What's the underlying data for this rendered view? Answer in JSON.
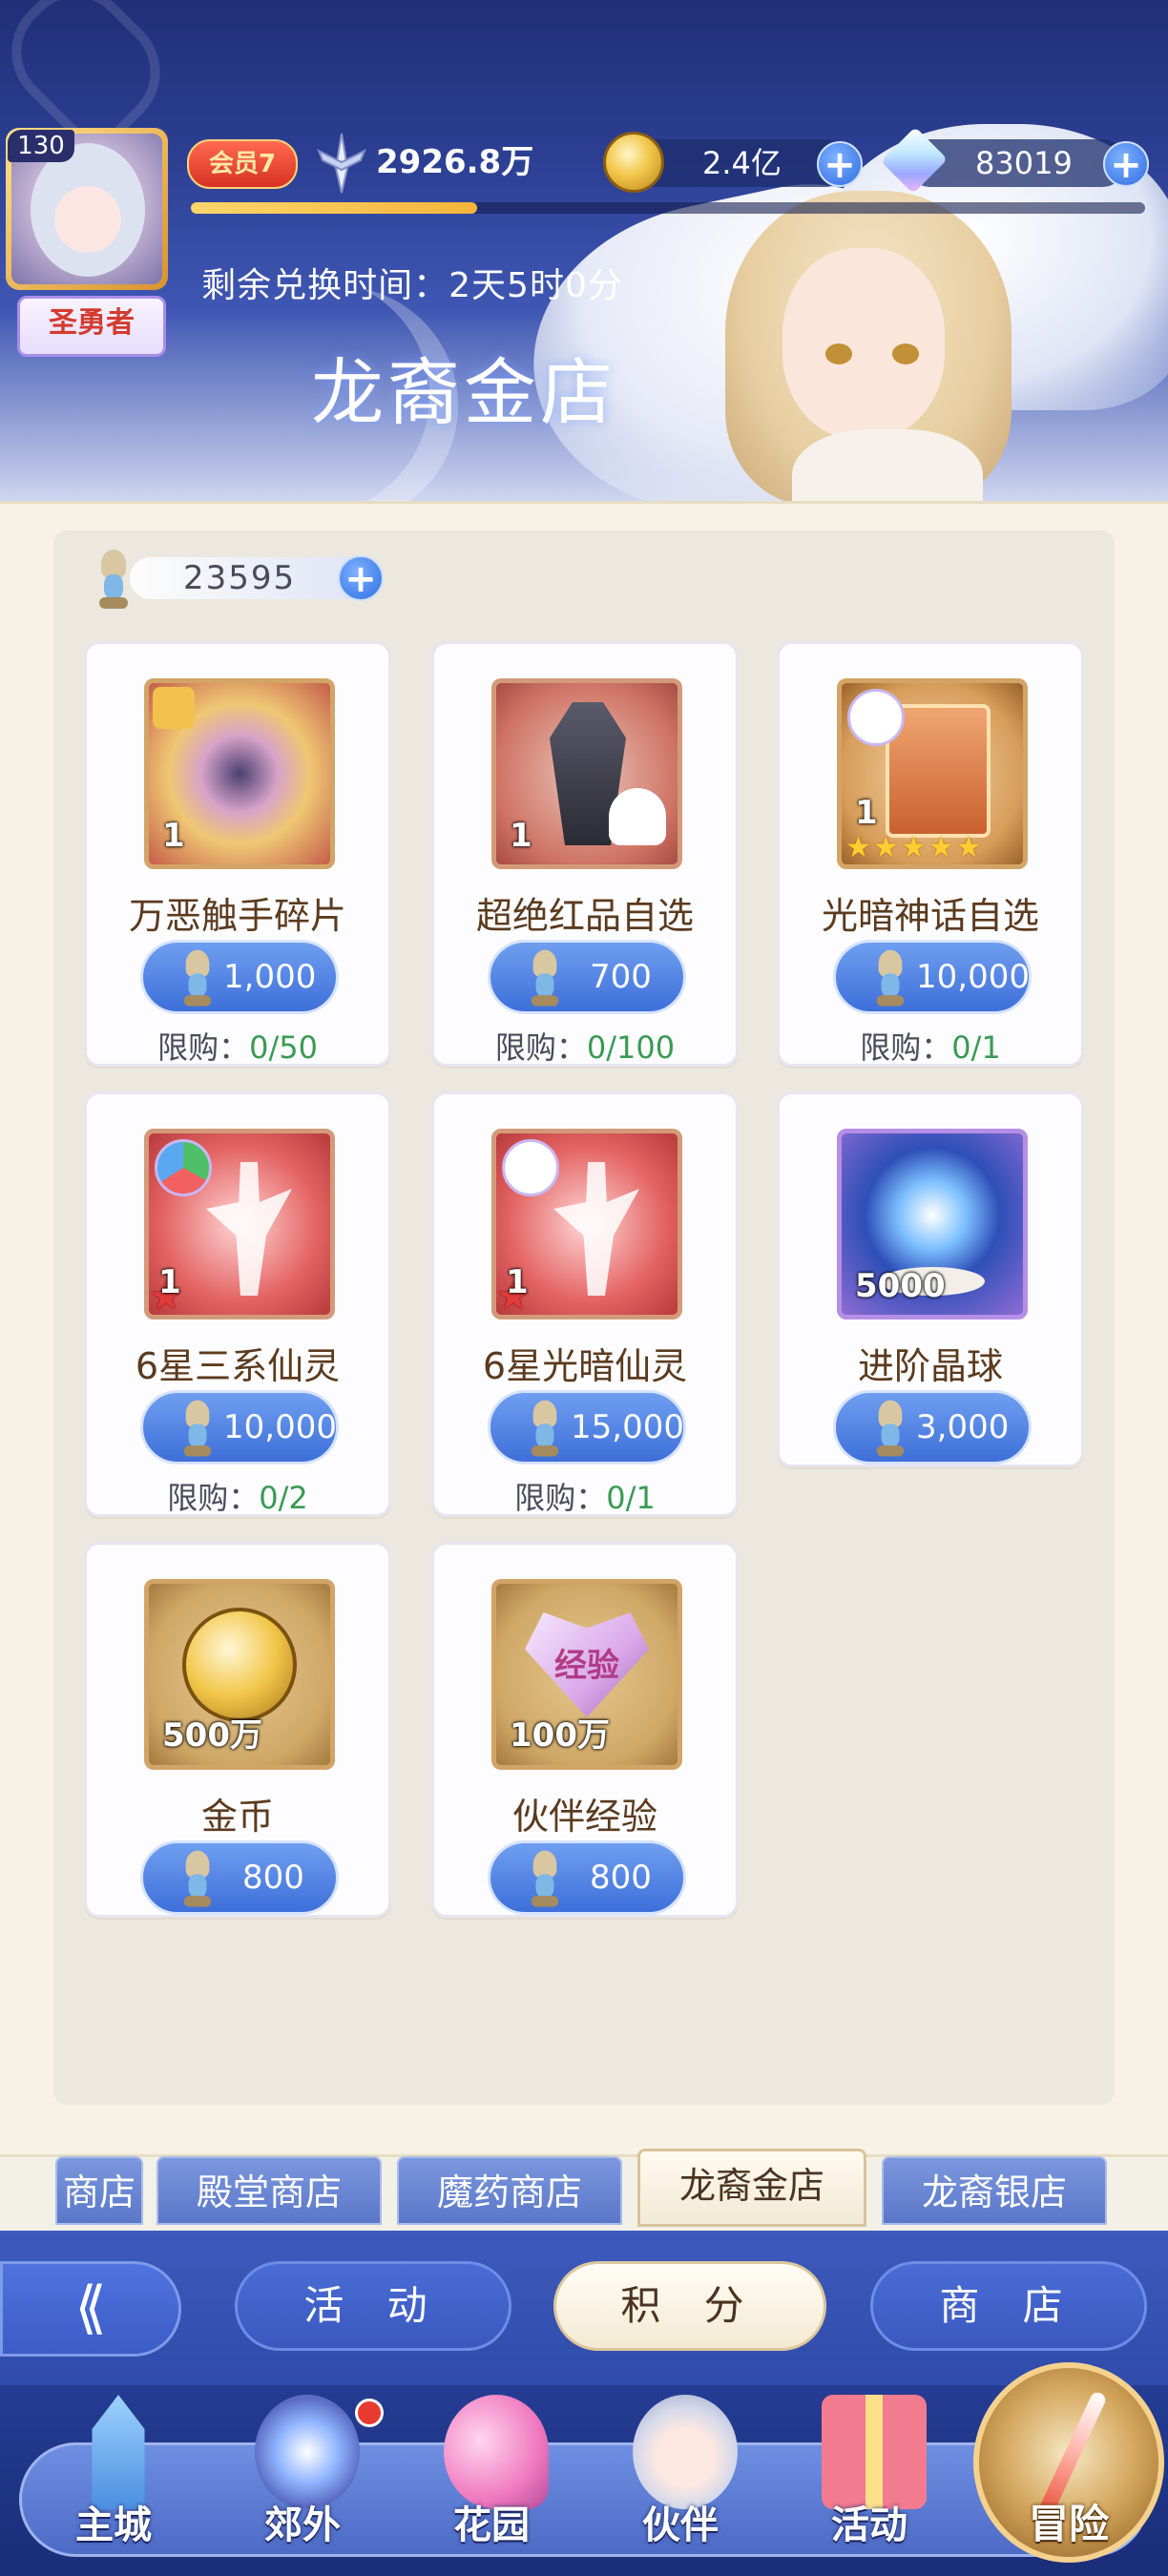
{
  "player": {
    "level": "130",
    "title": "圣勇者",
    "vip": "会员7",
    "power": "2926.8万",
    "exp_progress": 0.3
  },
  "currencies": {
    "gold": "2.4亿",
    "gems": "83019",
    "plus": "+"
  },
  "shop": {
    "timer": "剩余兑换时间：2天5时0分",
    "title": "龙裔金店",
    "points": "23595"
  },
  "items": [
    {
      "name": "万恶触手碎片",
      "qty": "1",
      "price": "1,000",
      "limit_label": "限购：",
      "limit_value": "0/50",
      "icon": "tentacle-fragment-icon"
    },
    {
      "name": "超绝红品自选",
      "qty": "1",
      "price": "700",
      "limit_label": "限购：",
      "limit_value": "0/100",
      "icon": "coffin-ghost-icon"
    },
    {
      "name": "光暗神话自选",
      "qty": "1",
      "price": "10,000",
      "limit_label": "限购：",
      "limit_value": "0/1",
      "icon": "light-dark-card-icon",
      "stars": 5
    },
    {
      "name": "6星三系仙灵",
      "qty": "1",
      "price": "10,000",
      "limit_label": "限购：",
      "limit_value": "0/2",
      "icon": "fairy-tri-element-icon"
    },
    {
      "name": "6星光暗仙灵",
      "qty": "1",
      "price": "15,000",
      "limit_label": "限购：",
      "limit_value": "0/1",
      "icon": "fairy-light-dark-icon"
    },
    {
      "name": "进阶晶球",
      "qty": "5000",
      "price": "3,000",
      "icon": "crystal-orb-icon"
    },
    {
      "name": "金币",
      "qty": "500万",
      "price": "800",
      "icon": "gold-coin-icon"
    },
    {
      "name": "伙伴经验",
      "qty": "100万",
      "price": "800",
      "icon": "exp-heart-icon",
      "icon_text": "经验"
    }
  ],
  "tabs": [
    "商店",
    "殿堂商店",
    "魔药商店",
    "龙裔金店",
    "龙裔银店"
  ],
  "active_tab": "龙裔金店",
  "sub_buttons": [
    "活 动",
    "积 分",
    "商 店"
  ],
  "nav": [
    "主城",
    "郊外",
    "花园",
    "伙伴",
    "活动",
    "冒险"
  ]
}
